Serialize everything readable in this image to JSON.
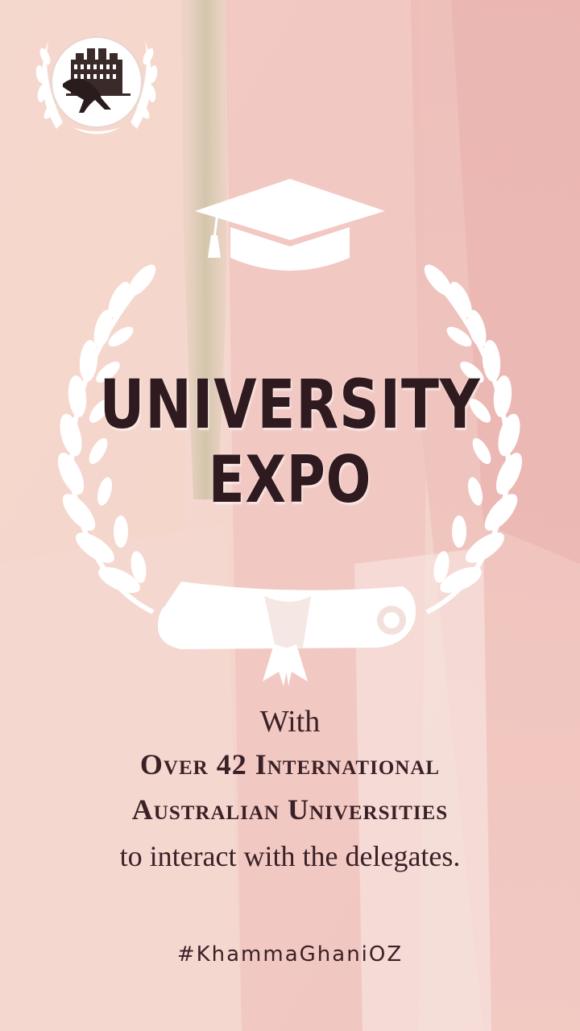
{
  "poster": {
    "title_line1": "UNIVERSITY",
    "title_line2": "EXPO",
    "intro": "With",
    "highlight_line1": "Over 42 International",
    "highlight_line2": "Australian Universities",
    "closing": "to interact with the delegates.",
    "hashtag": "#KhammaGhaniOZ"
  },
  "icons": [
    "emblem-logo-icon",
    "graduation-cap-icon",
    "laurel-wreath-icon",
    "diploma-scroll-icon"
  ],
  "colors": {
    "background": "#f3d3cb",
    "accent_stripe": "#e9b3b0",
    "gold_stripe": "#d9c7a8",
    "text_dark": "#2e1a1f",
    "ornament": "#ffffff"
  }
}
